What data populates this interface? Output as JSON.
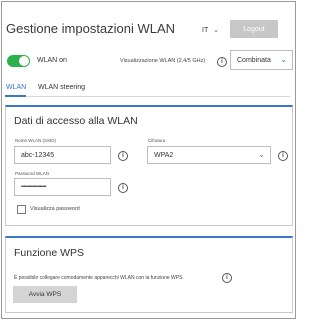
{
  "header": {
    "title": "Gestione impostazioni WLAN",
    "language": "IT",
    "logout_label": "Logout"
  },
  "status": {
    "wlan_toggle_on": true,
    "wlan_label": "WLAN on",
    "visibility_label": "Visualizzazione WLAN (2,4/5 GHz)",
    "visibility_value": "Combinata"
  },
  "tabs": [
    {
      "label": "WLAN",
      "active": true
    },
    {
      "label": "WLAN steering",
      "active": false
    }
  ],
  "access": {
    "title": "Dati di accesso alla WLAN",
    "ssid_label": "Nome WLAN (SSID)",
    "ssid_value": "abc-12345",
    "password_label": "Password WLAN",
    "password_value": "••••••••••••••••••••",
    "encryption_label": "Cifratura",
    "encryption_value": "WPA2",
    "show_password_label": "Visualizza password",
    "show_password_checked": false
  },
  "wps": {
    "title": "Funzione WPS",
    "description": "È possibile collegare comodamente apparecchi WLAN con la funzione WPS.",
    "button_label": "Avvia WPS"
  },
  "colors": {
    "accent": "#3b78c8",
    "toggle_on": "#2bb24c",
    "logout_bg": "#c7c7c7"
  },
  "icons": {
    "info": "info-icon",
    "dropdown": "chevron-down-icon"
  }
}
